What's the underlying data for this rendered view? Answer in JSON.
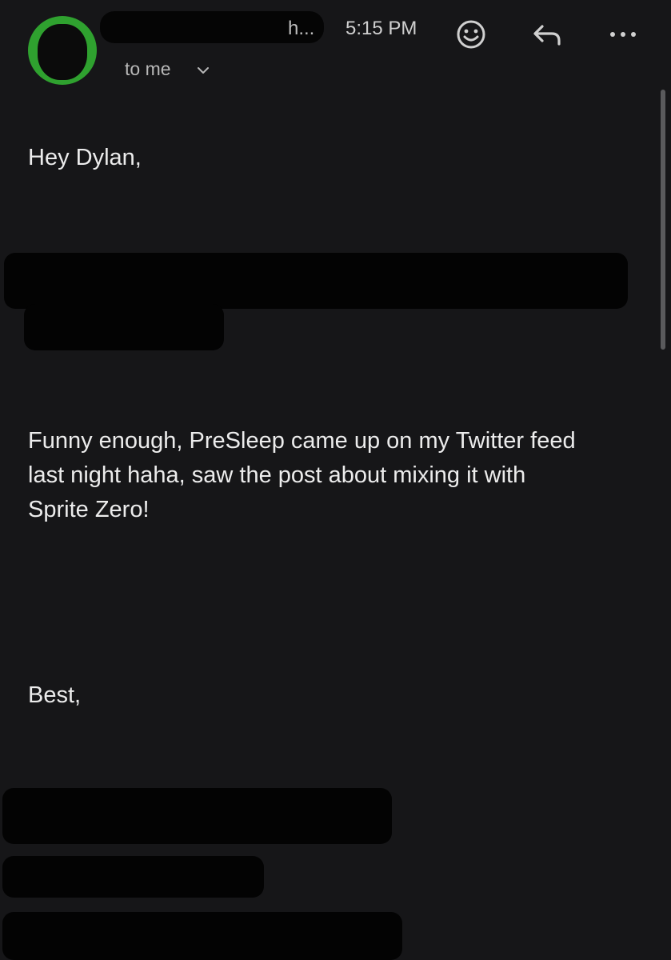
{
  "header": {
    "sender_visible_tail": "h...",
    "time": "5:15 PM",
    "recipient_label": "to me",
    "icons": [
      "emoji-icon",
      "reply-icon",
      "more-icon",
      "chevron-down-icon"
    ]
  },
  "email": {
    "greeting": "Hey Dylan,",
    "paragraph_lines": [
      "Funny enough, PreSleep came up on my Twitter feed",
      "last night haha, saw the post about mixing it with",
      "Sprite Zero!"
    ],
    "signoff": "Best,"
  },
  "colors": {
    "background": "#161618",
    "avatar": "#2fa12f",
    "redaction": "#030303",
    "text": "#ececec"
  }
}
